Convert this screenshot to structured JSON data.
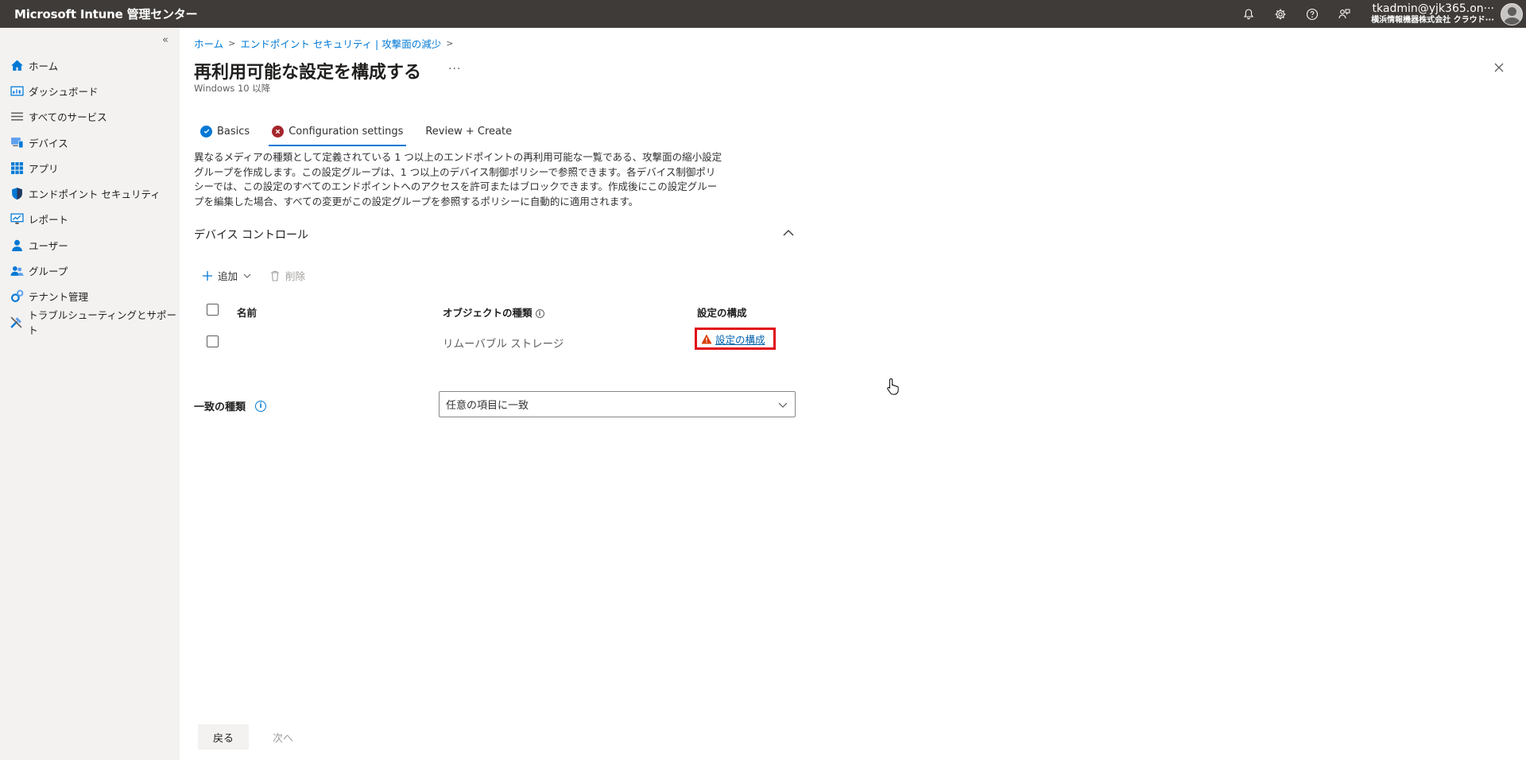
{
  "app": {
    "title": "Microsoft Intune 管理センター",
    "user": "tkadmin@yjk365.on···",
    "tenant": "横浜情報機器株式会社  クラウド···"
  },
  "sidebar": {
    "collapse_glyph": "«",
    "items": [
      {
        "label": "ホーム",
        "icon": "home-icon"
      },
      {
        "label": "ダッシュボード",
        "icon": "dashboard-icon"
      },
      {
        "label": "すべてのサービス",
        "icon": "list-icon"
      },
      {
        "label": "デバイス",
        "icon": "devices-icon"
      },
      {
        "label": "アプリ",
        "icon": "apps-icon"
      },
      {
        "label": "エンドポイント セキュリティ",
        "icon": "shield-icon"
      },
      {
        "label": "レポート",
        "icon": "reports-icon"
      },
      {
        "label": "ユーザー",
        "icon": "user-icon"
      },
      {
        "label": "グループ",
        "icon": "groups-icon"
      },
      {
        "label": "テナント管理",
        "icon": "tenant-admin-icon"
      },
      {
        "label": "トラブルシューティングとサポート",
        "icon": "troubleshoot-icon"
      }
    ]
  },
  "breadcrumb": [
    "ホーム",
    "エンドポイント セキュリティ | 攻撃面の減少"
  ],
  "page": {
    "title": "再利用可能な設定を構成する",
    "more": "···",
    "subtitle": "Windows 10 以降"
  },
  "tabs": [
    {
      "label": "Basics",
      "status": "complete"
    },
    {
      "label": "Configuration settings",
      "status": "error",
      "active": true
    },
    {
      "label": "Review + Create",
      "status": "none"
    }
  ],
  "description": [
    "異なるメディアの種類として定義されている 1 つ以上のエンドポイントの再利用可能な一覧である、攻撃面の縮小設定",
    "グループを作成します。この設定グループは、1 つ以上のデバイス制御ポリシーで参照できます。各デバイス制御ポリ",
    "シーでは、この設定のすべてのエンドポイントへのアクセスを許可またはブロックできます。作成後にこの設定グルー",
    "プを編集した場合、すべての変更がこの設定グループを参照するポリシーに自動的に適用されます。"
  ],
  "section": {
    "title": "デバイス コントロール"
  },
  "toolbar": {
    "add": "追加",
    "delete": "削除"
  },
  "table": {
    "headers": {
      "name": "名前",
      "object_type": "オブジェクトの種類",
      "config": "設定の構成"
    },
    "rows": [
      {
        "name": "",
        "object_type": "リムーバブル ストレージ",
        "config": "設定の構成"
      }
    ]
  },
  "match": {
    "label": "一致の種類",
    "value": "任意の項目に一致"
  },
  "footer": {
    "back": "戻る",
    "next": "次へ"
  },
  "colors": {
    "accent": "#0078d4",
    "error": "#a4262c",
    "warning": "#d83b01",
    "highlight": "#e00d14",
    "topbar": "#3f3b38"
  }
}
